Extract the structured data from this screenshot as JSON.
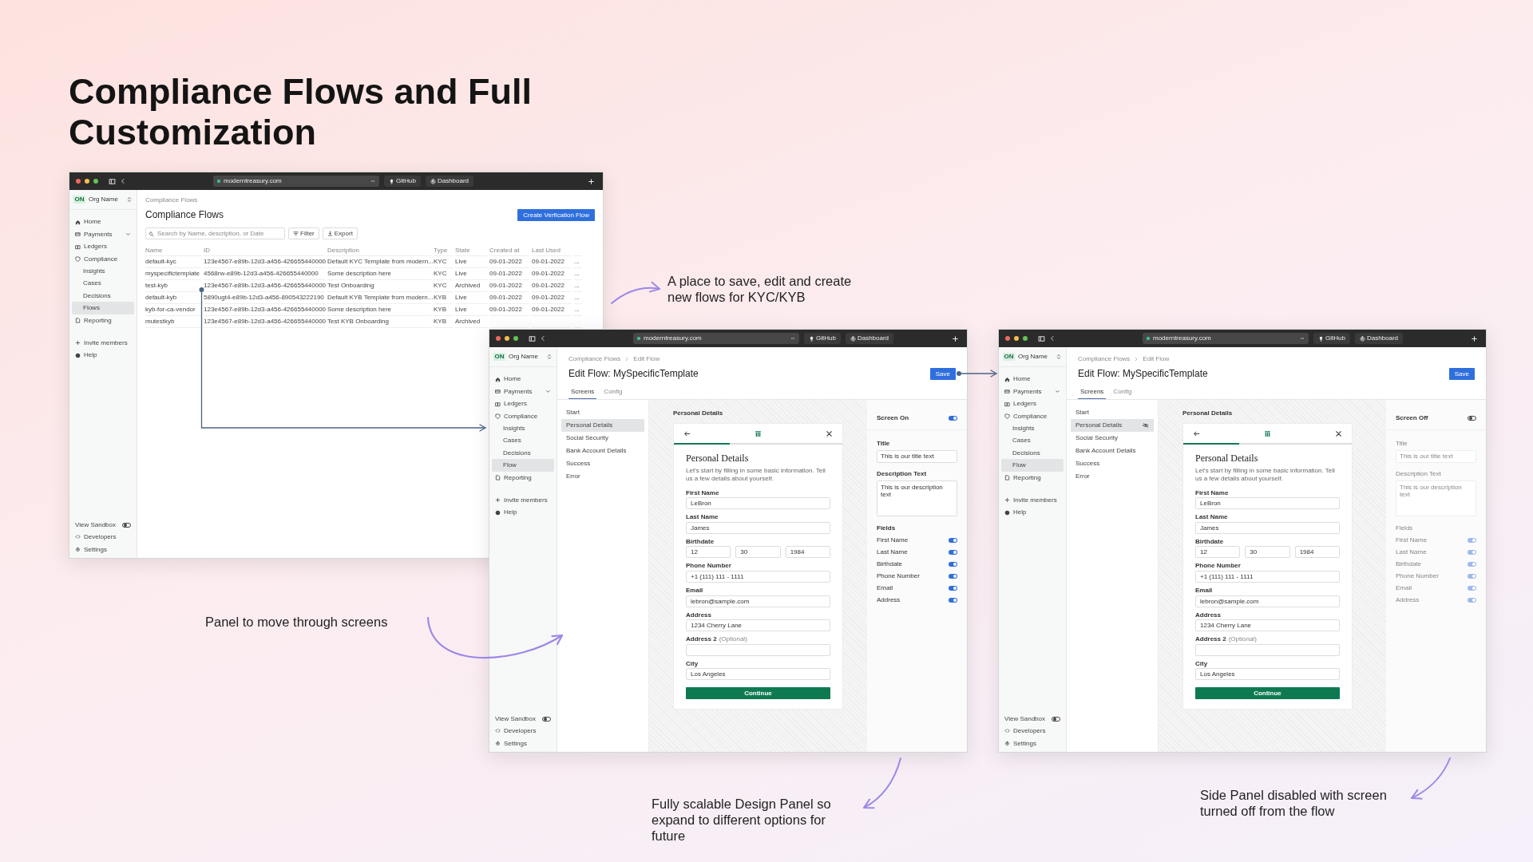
{
  "heading": "Compliance Flows and Full Customization",
  "annotations": [
    {
      "text": "A place to save, edit and create new flows for KYC/KYB"
    },
    {
      "text": "Panel to move through screens"
    },
    {
      "text": "Fully scalable Design Panel so expand to different options for future"
    },
    {
      "text": "Side Panel disabled with screen turned off from the flow"
    }
  ],
  "windows": [
    {
      "kind": "list",
      "browser": {
        "url": "moderntreasury.com",
        "bookmarks": [
          "GitHub",
          "Dashboard"
        ]
      },
      "sidebar": {
        "org": {
          "initials": "ON",
          "name": "Org Name"
        },
        "items": [
          {
            "label": "Home",
            "kind": "link",
            "selected": false
          },
          {
            "label": "Payments",
            "kind": "menu",
            "selected": false
          },
          {
            "label": "Ledgers",
            "kind": "link",
            "selected": false
          },
          {
            "label": "Compliance",
            "kind": "link",
            "selected": false,
            "children": [
              {
                "label": "Insights",
                "selected": false
              },
              {
                "label": "Cases",
                "selected": false
              },
              {
                "label": "Decisions",
                "selected": false
              },
              {
                "label": "Flows",
                "selected": true
              }
            ]
          },
          {
            "label": "Reporting",
            "kind": "link",
            "selected": false
          }
        ],
        "secondary": [
          "Invite members",
          "Help"
        ],
        "sandbox": {
          "label": "View Sandbox",
          "on": false
        },
        "footer": [
          "Developers",
          "Settings"
        ]
      },
      "breadcrumb": [
        "Compliance Flows"
      ],
      "title": "Compliance Flows",
      "primary_button": "Create Verfication Flow",
      "search": {
        "placeholder": "Search by Name, description, or Date"
      },
      "actions": [
        "Filter",
        "Export"
      ],
      "table": {
        "columns": [
          "Name",
          "ID",
          "Description",
          "Type",
          "State",
          "Created at",
          "Last Used"
        ],
        "rows": [
          {
            "cells": [
              "default-kyc",
              "123e4567-e89b-12d3-a456-426655440000",
              "Default KYC Template from modern...",
              "KYC",
              "Live",
              "09-01-2022",
              "09-01-2022",
              "..."
            ]
          },
          {
            "cells": [
              "myspecifictemplate",
              "4568rw-e89b-12d3-a456-426655440000",
              "Some description here",
              "KYC",
              "Live",
              "09-01-2022",
              "09-01-2022",
              "..."
            ]
          },
          {
            "cells": [
              "test-kyb",
              "123e4567-e89b-12d3-a456-426655440000",
              "Test Onboarding",
              "KYC",
              "Archived",
              "09-01-2022",
              "09-01-2022",
              "..."
            ]
          },
          {
            "cells": [
              "default-kyb",
              "5890ugt4-e89b-12d3-a456-890543222190",
              "Default KYB Template from modern...",
              "KYB",
              "Live",
              "09-01-2022",
              "09-01-2022",
              "..."
            ]
          },
          {
            "cells": [
              "kyb-for-ca-vendor",
              "123e4567-e89b-12d3-a456-426655440000",
              "Some description here",
              "KYB",
              "Live",
              "09-01-2022",
              "09-01-2022",
              "..."
            ]
          },
          {
            "cells": [
              "mutestkyb",
              "123e4567-e89b-12d3-a456-426655440000",
              "Test KYB Onboarding",
              "KYB",
              "Archived"
            ]
          }
        ]
      }
    },
    {
      "kind": "editor",
      "browser": {
        "url": "moderntreasury.com",
        "bookmarks": [
          "GitHub",
          "Dashboard"
        ]
      },
      "sidebar": {
        "org": {
          "initials": "ON",
          "name": "Org Name"
        },
        "items": [
          {
            "label": "Home",
            "kind": "link",
            "selected": false
          },
          {
            "label": "Payments",
            "kind": "menu",
            "selected": false
          },
          {
            "label": "Ledgers",
            "kind": "link",
            "selected": false
          },
          {
            "label": "Compliance",
            "kind": "link",
            "selected": false,
            "children": [
              {
                "label": "Insights",
                "selected": false
              },
              {
                "label": "Cases",
                "selected": false
              },
              {
                "label": "Decisions",
                "selected": false
              },
              {
                "label": "Flow",
                "selected": true
              }
            ]
          },
          {
            "label": "Reporting",
            "kind": "link",
            "selected": false
          }
        ],
        "secondary": [
          "Invite members",
          "Help"
        ],
        "sandbox": {
          "label": "View Sandbox",
          "on": false
        },
        "footer": [
          "Developers",
          "Settings"
        ]
      },
      "breadcrumb": [
        "Compliance Flows",
        "Edit Flow"
      ],
      "title": "Edit Flow: MySpecificTemplate",
      "save_button": "Save",
      "tabs": [
        {
          "label": "Screens",
          "selected": true
        },
        {
          "label": "Config",
          "selected": false
        }
      ],
      "screens": [
        {
          "label": "Start",
          "selected": false,
          "hidden": false
        },
        {
          "label": "Personal Details",
          "selected": true,
          "hidden": false
        },
        {
          "label": "Social Security",
          "selected": false,
          "hidden": false
        },
        {
          "label": "Bank Account Details",
          "selected": false,
          "hidden": false
        },
        {
          "label": "Success",
          "selected": false,
          "hidden": false
        },
        {
          "label": "Error",
          "selected": false,
          "hidden": false
        }
      ],
      "preview": {
        "label": "Personal Details",
        "progress": {
          "level": 0.33
        },
        "title": "Personal Details",
        "description": "Let's start by filling in some basic information. Tell us a few details about yourself.",
        "fields": [
          {
            "kind": "text",
            "label": "First Name",
            "value": "LeBron"
          },
          {
            "kind": "text",
            "label": "Last Name",
            "value": "James"
          },
          {
            "kind": "date",
            "label": "Birthdate",
            "values": [
              "12",
              "30",
              "1984"
            ]
          },
          {
            "kind": "text",
            "label": "Phone Number",
            "value": "+1 (111) 111 - 1111"
          },
          {
            "kind": "text",
            "label": "Email",
            "value": "lebron@sample.com"
          },
          {
            "kind": "text",
            "label": "Address",
            "value": "1234 Cherry Lane"
          },
          {
            "kind": "text",
            "label": "Address 2",
            "note": "(Optional)"
          },
          {
            "kind": "text",
            "label": "City",
            "value": "Los Angeles"
          }
        ],
        "button": "Continue"
      },
      "panel": {
        "disabled": false,
        "screen_toggle": {
          "label": "Screen On",
          "on": true
        },
        "title_field": {
          "label": "Title",
          "value": "This is our title text"
        },
        "description_field": {
          "label": "Description Text",
          "value": "This is our description text"
        },
        "fields_heading": "Fields",
        "field_toggles": [
          {
            "label": "First Name",
            "on": true
          },
          {
            "label": "Last Name",
            "on": true
          },
          {
            "label": "Birthdate",
            "on": true
          },
          {
            "label": "Phone Number",
            "on": true
          },
          {
            "label": "Email",
            "on": true
          },
          {
            "label": "Address",
            "on": true
          }
        ]
      }
    },
    {
      "kind": "editor",
      "browser": {
        "url": "moderntreasury.com",
        "bookmarks": [
          "GitHub",
          "Dashboard"
        ]
      },
      "sidebar": {
        "org": {
          "initials": "ON",
          "name": "Org Name"
        },
        "items": [
          {
            "label": "Home",
            "kind": "link",
            "selected": false
          },
          {
            "label": "Payments",
            "kind": "menu",
            "selected": false
          },
          {
            "label": "Ledgers",
            "kind": "link",
            "selected": false
          },
          {
            "label": "Compliance",
            "kind": "link",
            "selected": false,
            "children": [
              {
                "label": "Insights",
                "selected": false
              },
              {
                "label": "Cases",
                "selected": false
              },
              {
                "label": "Decisions",
                "selected": false
              },
              {
                "label": "Flow",
                "selected": true
              }
            ]
          },
          {
            "label": "Reporting",
            "kind": "link",
            "selected": false
          }
        ],
        "secondary": [
          "Invite members",
          "Help"
        ],
        "sandbox": {
          "label": "View Sandbox",
          "on": false
        },
        "footer": [
          "Developers",
          "Settings"
        ]
      },
      "breadcrumb": [
        "Compliance Flows",
        "Edit Flow"
      ],
      "title": "Edit Flow: MySpecificTemplate",
      "save_button": "Save",
      "tabs": [
        {
          "label": "Screens",
          "selected": true
        },
        {
          "label": "Config",
          "selected": false
        }
      ],
      "screens": [
        {
          "label": "Start",
          "selected": false,
          "hidden": false
        },
        {
          "label": "Personal Details",
          "selected": true,
          "hidden": true
        },
        {
          "label": "Social Security",
          "selected": false,
          "hidden": false
        },
        {
          "label": "Bank Account Details",
          "selected": false,
          "hidden": false
        },
        {
          "label": "Success",
          "selected": false,
          "hidden": false
        },
        {
          "label": "Error",
          "selected": false,
          "hidden": false
        }
      ],
      "preview": {
        "label": "Personal Details",
        "progress": {
          "level": 0.33
        },
        "title": "Personal Details",
        "description": "Let's start by filling in some basic information. Tell us a few details about yourself.",
        "fields": [
          {
            "kind": "text",
            "label": "First Name",
            "value": "LeBron"
          },
          {
            "kind": "text",
            "label": "Last Name",
            "value": "James"
          },
          {
            "kind": "date",
            "label": "Birthdate",
            "values": [
              "12",
              "30",
              "1984"
            ]
          },
          {
            "kind": "text",
            "label": "Phone Number",
            "value": "+1 (111) 111 - 1111"
          },
          {
            "kind": "text",
            "label": "Email",
            "value": "lebron@sample.com"
          },
          {
            "kind": "text",
            "label": "Address",
            "value": "1234 Cherry Lane"
          },
          {
            "kind": "text",
            "label": "Address 2",
            "note": "(Optional)"
          },
          {
            "kind": "text",
            "label": "City",
            "value": "Los Angeles"
          }
        ],
        "button": "Continue"
      },
      "panel": {
        "disabled": true,
        "screen_toggle": {
          "label": "Screen Off",
          "on": false
        },
        "title_field": {
          "label": "Title",
          "placeholder": "This is our title text"
        },
        "description_field": {
          "label": "Description Text",
          "placeholder": "This is our description text"
        },
        "fields_heading": "Fields",
        "field_toggles": [
          {
            "label": "First Name",
            "on": true
          },
          {
            "label": "Last Name",
            "on": true
          },
          {
            "label": "Birthdate",
            "on": true
          },
          {
            "label": "Phone Number",
            "on": true
          },
          {
            "label": "Email",
            "on": true
          },
          {
            "label": "Address",
            "on": true
          }
        ]
      }
    }
  ]
}
